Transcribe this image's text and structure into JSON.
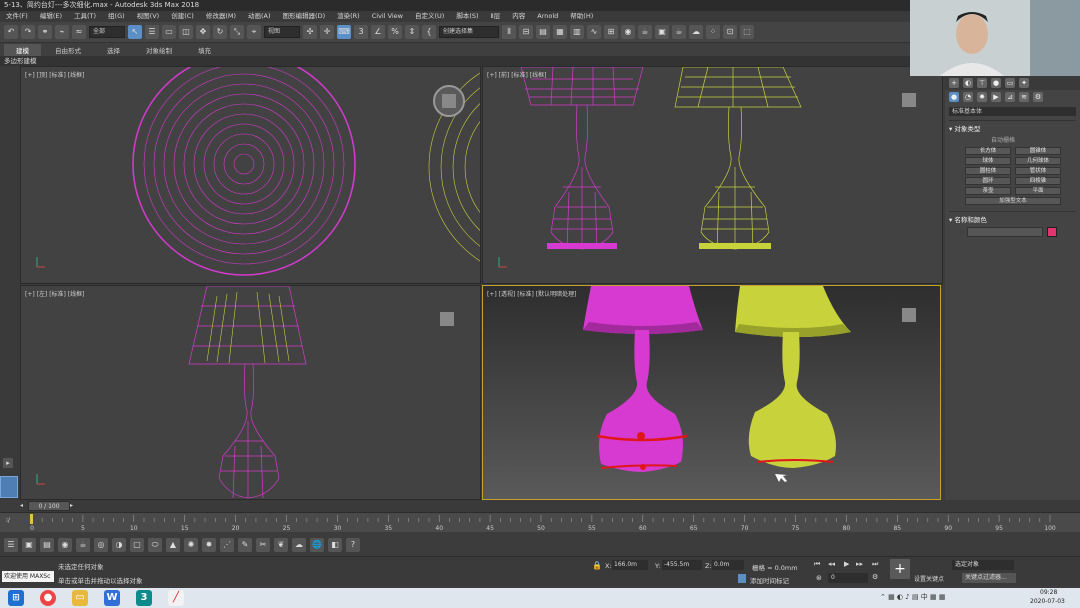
{
  "window": {
    "title": "5-13、简约台灯---多次细化.max - Autodesk 3ds Max 2018"
  },
  "menu": [
    "文件(F)",
    "编辑(E)",
    "工具(T)",
    "组(G)",
    "视图(V)",
    "创建(C)",
    "修改器(M)",
    "动画(A)",
    "图形编辑器(D)",
    "渲染(R)",
    "Civil View",
    "自定义(U)",
    "脚本(S)",
    "Ⅱ层",
    "内容",
    "Arnold",
    "帮助(H)"
  ],
  "toolbar": {
    "filter_value": "全部",
    "view_value": "视图",
    "selection_set_value": "创建选择集"
  },
  "ribbon": {
    "tabs": [
      "建模",
      "自由形式",
      "选择",
      "对象绘制",
      "填充"
    ],
    "active": "建模",
    "sub_label": "多边形建模"
  },
  "viewports": {
    "top": "[+] [顶] [标准] [线框]",
    "front": "[+] [前] [标准] [线框]",
    "left": "[+] [左] [标准] [线框]",
    "persp": "[+] [透视] [标准] [默认明暗处理]"
  },
  "colors": {
    "magenta": "#d63ad0",
    "yellow": "#c8d23a",
    "active_border": "#c8a030",
    "annotation": "#e0161a"
  },
  "command_panel": {
    "dropdown": "标准基本体",
    "rollout_object_type": "对象类型",
    "autogrid": "自动栅格",
    "buttons": [
      "长方体",
      "圆锥体",
      "球体",
      "几何球体",
      "圆柱体",
      "管状体",
      "圆环",
      "四棱锥",
      "茶壶",
      "平面"
    ],
    "extra_button": "加强型文本",
    "rollout_name_color": "名称和颜色",
    "object_color": "#e2356e"
  },
  "timeline": {
    "frame_label": "0 / 100",
    "ticks": [
      "0",
      "5",
      "10",
      "15",
      "20",
      "25",
      "30",
      "35",
      "40",
      "45",
      "50",
      "55",
      "60",
      "65",
      "70",
      "75",
      "80",
      "85",
      "90",
      "95",
      "100"
    ]
  },
  "status": {
    "script_label": "欢迎使用 MAXSc",
    "line1": "未选定任何对象",
    "line2": "单击或单击并拖动以选择对象",
    "x_label": "X:",
    "x_value": "166.0m",
    "y_label": "Y:",
    "y_value": "-455.5m",
    "z_label": "Z:",
    "z_value": "0.0m",
    "grid_label": "栅格 = 0.0mm",
    "add_time_tag": "添加时间标记",
    "frame_field": "0",
    "selected_obj": "选定对象",
    "set_key": "设置关键点",
    "key_filters": "关键点过滤器..."
  },
  "taskbar": {
    "clock_time": "09:28",
    "clock_date": "2020-07-03"
  }
}
